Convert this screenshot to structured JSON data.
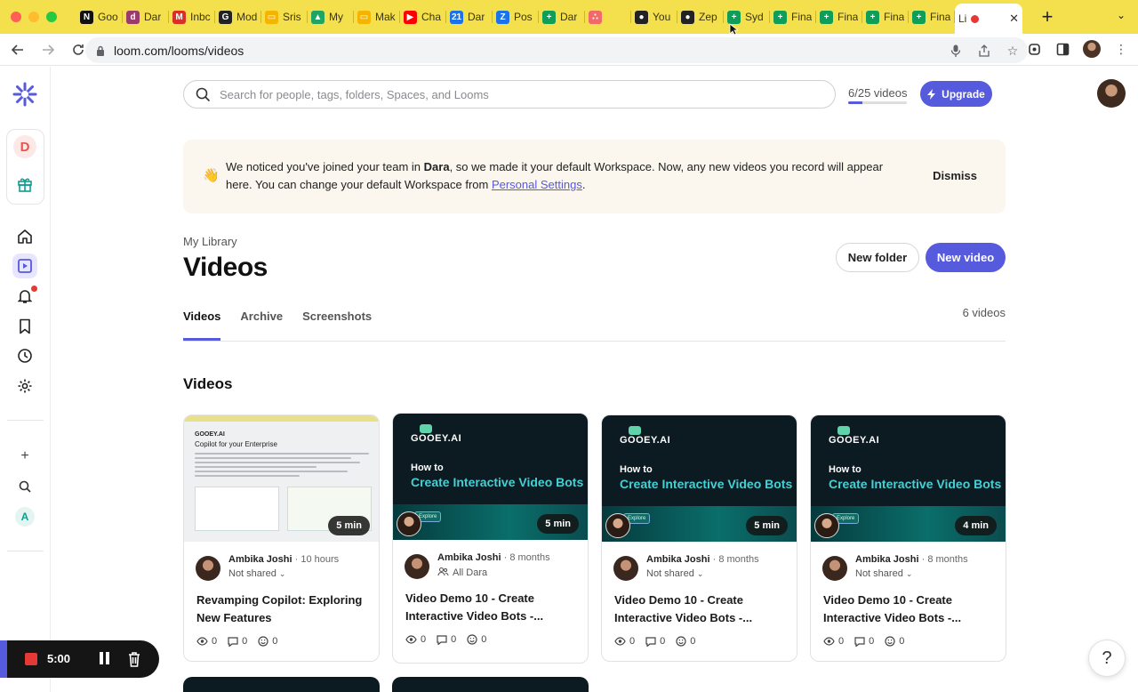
{
  "browser": {
    "tabs": [
      {
        "label": "Goo",
        "icon": "notion-icon",
        "color": "#111111",
        "glyph": "N"
      },
      {
        "label": "Dar",
        "icon": "dara-icon",
        "color": "#9b3b6b",
        "glyph": "d"
      },
      {
        "label": "Inbc",
        "icon": "gmail-icon",
        "color": "#d93025",
        "glyph": "M"
      },
      {
        "label": "Mod",
        "icon": "generic-g-icon",
        "color": "#222222",
        "glyph": "G"
      },
      {
        "label": "Sris",
        "icon": "slides-icon",
        "color": "#f4b400",
        "glyph": "▭"
      },
      {
        "label": "My",
        "icon": "drive-icon",
        "color": "#1fa463",
        "glyph": "▲"
      },
      {
        "label": "Mak",
        "icon": "slides-icon",
        "color": "#f4b400",
        "glyph": "▭"
      },
      {
        "label": "Cha",
        "icon": "youtube-icon",
        "color": "#ff0000",
        "glyph": "▶"
      },
      {
        "label": "Dar",
        "icon": "calendar-icon",
        "color": "#1a73e8",
        "glyph": "21"
      },
      {
        "label": "Pos",
        "icon": "zoho-icon",
        "color": "#1a73e8",
        "glyph": "Z"
      },
      {
        "label": "Dar",
        "icon": "sheets-icon",
        "color": "#0f9d58",
        "glyph": "+"
      },
      {
        "label": "",
        "icon": "asana-icon",
        "color": "#f06a6a",
        "glyph": "∴"
      },
      {
        "label": "You",
        "icon": "loom-rec-icon",
        "color": "#222222",
        "glyph": "●"
      },
      {
        "label": "Zep",
        "icon": "loom-rec-icon",
        "color": "#222222",
        "glyph": "●"
      },
      {
        "label": "Syd",
        "icon": "sheets-icon",
        "color": "#0f9d58",
        "glyph": "+"
      },
      {
        "label": "Fina",
        "icon": "sheets-icon",
        "color": "#0f9d58",
        "glyph": "+"
      },
      {
        "label": "Fina",
        "icon": "sheets-icon",
        "color": "#0f9d58",
        "glyph": "+"
      },
      {
        "label": "Fina",
        "icon": "sheets-icon",
        "color": "#0f9d58",
        "glyph": "+"
      },
      {
        "label": "Fina",
        "icon": "sheets-icon",
        "color": "#0f9d58",
        "glyph": "+"
      }
    ],
    "active_tab": {
      "label": "Li",
      "icon": "loom-icon"
    },
    "url": "loom.com/looms/videos"
  },
  "search": {
    "placeholder": "Search for people, tags, folders, Spaces, and Looms"
  },
  "quota": {
    "label": "6/25 videos",
    "used": 6,
    "limit": 25
  },
  "upgrade_label": "Upgrade",
  "banner": {
    "text_before": "We noticed you've joined your team in ",
    "team": "Dara",
    "text_after": ", so we made it your default Workspace. Now, any new videos you record will appear here. You can change your default Workspace from ",
    "link": "Personal Settings",
    "end": ".",
    "dismiss": "Dismiss"
  },
  "breadcrumb": "My Library",
  "title": "Videos",
  "buttons": {
    "new_folder": "New folder",
    "new_video": "New video"
  },
  "tabs": [
    {
      "label": "Videos",
      "active": true
    },
    {
      "label": "Archive",
      "active": false
    },
    {
      "label": "Screenshots",
      "active": false
    }
  ],
  "count_label": "6 videos",
  "section_title": "Videos",
  "rail": {
    "workspace_initial": "D",
    "app_initial": "A"
  },
  "cards": [
    {
      "author": "Ambika Joshi",
      "ago": "10 hours",
      "share": "Not shared",
      "title": "Revamping Copilot: Exploring New Features",
      "duration": "5 min",
      "views": "0",
      "comments": "0",
      "reactions": "0",
      "thumb_type": "doc",
      "thumb_logo": "GOOEY.AI",
      "thumb_title": "Copilot for your Enterprise"
    },
    {
      "author": "Ambika Joshi",
      "ago": "8 months",
      "share": "All Dara",
      "title": "Video Demo 10 - Create Interactive Video Bots -...",
      "duration": "5 min",
      "views": "0",
      "comments": "0",
      "reactions": "0",
      "thumb_type": "promo",
      "thumb_logo": "GOOEY.AI",
      "thumb_how": "How to",
      "thumb_big": "Create Interactive Video Bots",
      "thumb_pill": "Explore"
    },
    {
      "author": "Ambika Joshi",
      "ago": "8 months",
      "share": "Not shared",
      "title": "Video Demo 10 - Create Interactive Video Bots -...",
      "duration": "5 min",
      "views": "0",
      "comments": "0",
      "reactions": "0",
      "thumb_type": "promo",
      "thumb_logo": "GOOEY.AI",
      "thumb_how": "How to",
      "thumb_big": "Create Interactive Video Bots",
      "thumb_pill": "Explore"
    },
    {
      "author": "Ambika Joshi",
      "ago": "8 months",
      "share": "Not shared",
      "title": "Video Demo 10 - Create Interactive Video Bots -...",
      "duration": "4 min",
      "views": "0",
      "comments": "0",
      "reactions": "0",
      "thumb_type": "promo",
      "thumb_logo": "GOOEY.AI",
      "thumb_how": "How to",
      "thumb_big": "Create Interactive Video Bots",
      "thumb_pill": "Explore"
    }
  ],
  "recorder": {
    "time": "5:00"
  },
  "help": "?",
  "colors": {
    "accent": "#565add",
    "tabstrip": "#f4e04d",
    "banner": "#fbf6ee",
    "notification": "#e53935"
  }
}
